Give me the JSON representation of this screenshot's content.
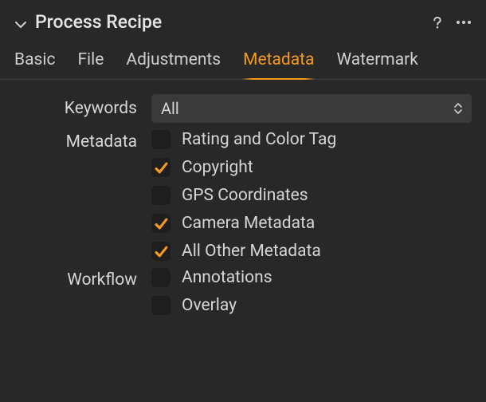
{
  "colors": {
    "accent": "#f39a1f",
    "background": "#282828",
    "text": "#d6d6d6"
  },
  "header": {
    "title": "Process Recipe"
  },
  "tabs": [
    {
      "label": "Basic",
      "active": false
    },
    {
      "label": "File",
      "active": false
    },
    {
      "label": "Adjustments",
      "active": false
    },
    {
      "label": "Metadata",
      "active": true
    },
    {
      "label": "Watermark",
      "active": false
    }
  ],
  "keywords": {
    "label": "Keywords",
    "selected": "All"
  },
  "metadata": {
    "label": "Metadata",
    "options": [
      {
        "label": "Rating and Color Tag",
        "checked": false
      },
      {
        "label": "Copyright",
        "checked": true
      },
      {
        "label": "GPS Coordinates",
        "checked": false
      },
      {
        "label": "Camera Metadata",
        "checked": true
      },
      {
        "label": "All Other Metadata",
        "checked": true
      }
    ]
  },
  "workflow": {
    "label": "Workflow",
    "options": [
      {
        "label": "Annotations",
        "checked": false
      },
      {
        "label": "Overlay",
        "checked": false
      }
    ]
  }
}
